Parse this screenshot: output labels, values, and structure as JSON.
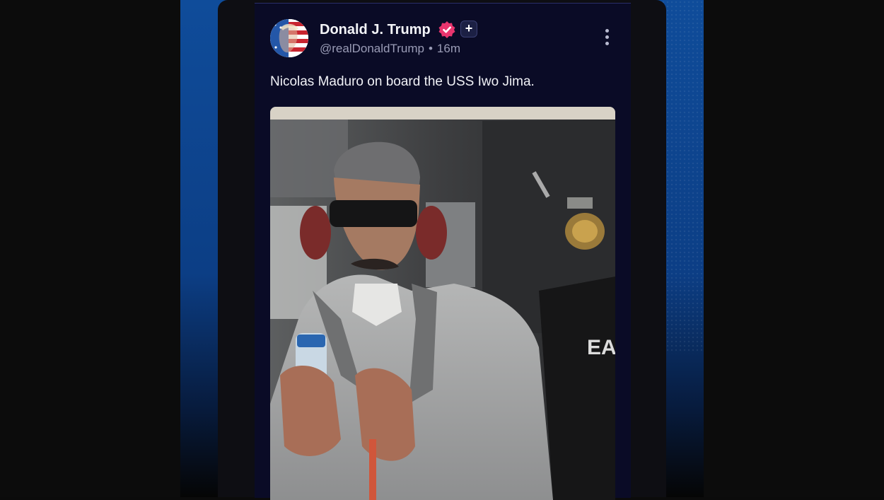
{
  "post": {
    "author_name": "Donald J. Trump",
    "handle": "@realDonaldTrump",
    "separator": "•",
    "time_ago": "16m",
    "plus_label": "+",
    "text": "Nicolas Maduro on board the USS Iwo Jima."
  },
  "icons": {
    "avatar": "flag-portrait-avatar",
    "verified": "verified-badge-icon",
    "plus": "plus-icon",
    "more": "more-vertical-icon"
  },
  "colors": {
    "post_background": "#0a0b26",
    "verified_badge": "#e8356e",
    "backdrop_blue": "#0f4c9a"
  }
}
